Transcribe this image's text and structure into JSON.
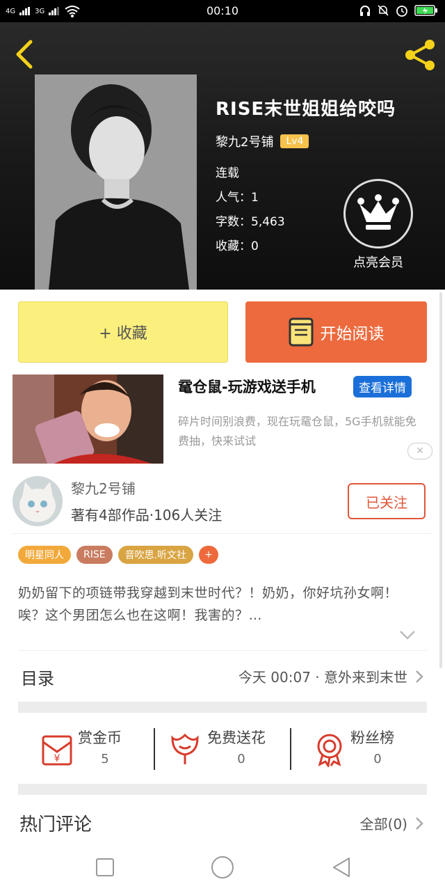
{
  "status_bar": {
    "time": "00:10",
    "network_1": "4G",
    "network_2": "3G"
  },
  "header": {
    "back_icon": "chevron-left-icon",
    "share_icon": "share-icon",
    "accent_color": "#f5d21a"
  },
  "book": {
    "title": "RISE末世姐姐给咬吗",
    "author": "黎九2号铺",
    "level": "Lv4",
    "status": "连载",
    "popularity": "人气：1",
    "word_count": "字数：5,463",
    "favorites": "收藏：0",
    "vip_label": "点亮会员"
  },
  "actions": {
    "collect_label": "+ 收藏",
    "read_label": "开始阅读",
    "collect_color": "#fbf07d",
    "read_color": "#ec6a3e"
  },
  "ad": {
    "title": "鼋仓鼠-玩游戏送手机",
    "link_label": "查看详情",
    "description": "碎片时间别浪费，现在玩鼋仓鼠，5G手机就能免费抽，快来试试",
    "close_label": "✕"
  },
  "author_card": {
    "name": "黎九2号铺",
    "stats": "著有4部作品·106人关注",
    "follow_label": "已关注"
  },
  "tags": [
    {
      "label": "明星同人",
      "color": "#f2a93b"
    },
    {
      "label": "RISE",
      "color": "#c97c60"
    },
    {
      "label": "音吹思.听文社",
      "color": "#d9a442"
    },
    {
      "label": "+",
      "color": "#ee6a3c"
    }
  ],
  "synopsis": "奶奶留下的项链带我穿越到末世时代？！奶奶，你好坑孙女啊！唉？这个男团怎么也在这啊！我害的？…",
  "toc": {
    "label": "目录",
    "latest": "今天 00:07 · 意外来到末世"
  },
  "rewards": [
    {
      "label": "赏金币",
      "count": "5",
      "icon": "red-envelope-icon"
    },
    {
      "label": "免费送花",
      "count": "0",
      "icon": "flower-icon"
    },
    {
      "label": "粉丝榜",
      "count": "0",
      "icon": "medal-icon"
    }
  ],
  "comments": {
    "label": "热门评论",
    "all_label": "全部(0)"
  },
  "nav": {
    "recent": "square-icon",
    "home": "circle-icon",
    "back": "triangle-back-icon"
  }
}
